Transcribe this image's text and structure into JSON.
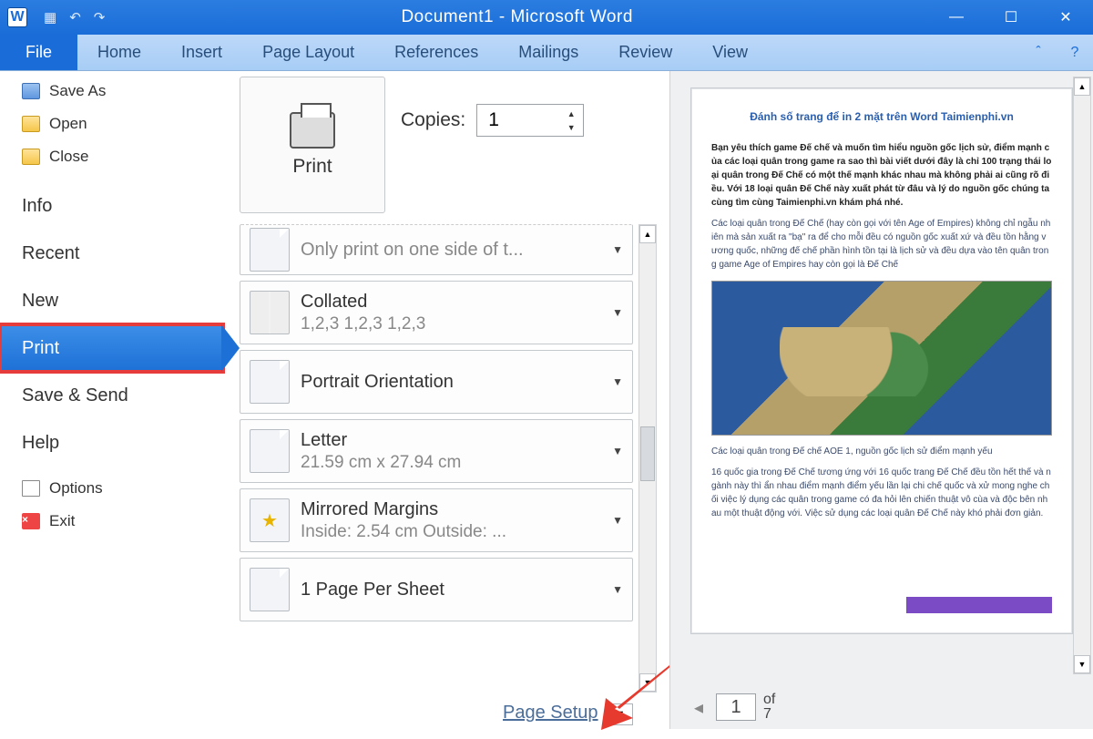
{
  "window": {
    "title": "Document1 - Microsoft Word"
  },
  "tabs": {
    "file": "File",
    "home": "Home",
    "insert": "Insert",
    "page_layout": "Page Layout",
    "references": "References",
    "mailings": "Mailings",
    "review": "Review",
    "view": "View"
  },
  "nav": {
    "save_as": "Save As",
    "open": "Open",
    "close": "Close",
    "info": "Info",
    "recent": "Recent",
    "new": "New",
    "print": "Print",
    "save_send": "Save & Send",
    "help": "Help",
    "options": "Options",
    "exit": "Exit"
  },
  "print": {
    "button": "Print",
    "copies_label": "Copies:",
    "copies_value": "1",
    "settings": {
      "sides_sub": "Only print on one side of t...",
      "collate": "Collated",
      "collate_sub": "1,2,3    1,2,3    1,2,3",
      "orient": "Portrait Orientation",
      "size": "Letter",
      "size_sub": "21.59 cm x 27.94 cm",
      "margins": "Mirrored Margins",
      "margins_sub": "Inside:  2.54 cm    Outside: ...",
      "sheet": "1 Page Per Sheet"
    },
    "page_setup": "Page Setup"
  },
  "preview": {
    "title": "Đánh số trang để in 2 mặt trên Word Taimienphi.vn",
    "p1": "Bạn yêu thích game Đế chế và muốn tìm hiểu nguồn gốc lịch sử, điểm mạnh của các loại quân trong game ra sao thì bài viết dưới đây là chỉ 100 trạng thái loại quân trong Đế Chế có một thế mạnh khác nhau mà không phải ai cũng rõ điều. Với 18 loại quân Đế Chế này xuất phát từ đâu và lý do nguồn gốc chúng ta cùng tìm cùng Taimienphi.vn khám phá nhé.",
    "p2": "Các loại quân trong Đế Chế (hay còn gọi với tên Age of Empires) không chỉ ngẫu nhiên mà sản xuất ra \"bạ\" ra để cho mỗi đều có nguồn gốc xuất xứ và đều tồn hằng vương quốc, những đế chế phần hình tồn tại là lịch sử và đều dựa vào tên quân trong game Age of Empires hay còn gọi là Đế Chế",
    "p3": "Các loại quân trong Đế chế AOE 1, nguồn gốc lịch sử điểm mạnh yếu",
    "p4": "16 quốc gia trong Đế Chế tương ứng với 16 quốc trang Đế Chế đều tồn hết thế và ngành này thì ẩn nhau điểm mạnh điểm yếu lần lại chi chế quốc và xử mong nghe chối việc lý dụng các quân trong game có đa hỏi lên chiến thuật vô cùa và độc bên nhau một thuật động với. Việc sử dụng các loại quân Đế Chế này khó phải đơn giản.",
    "page_current": "1",
    "page_of": "of",
    "page_total": "7"
  }
}
